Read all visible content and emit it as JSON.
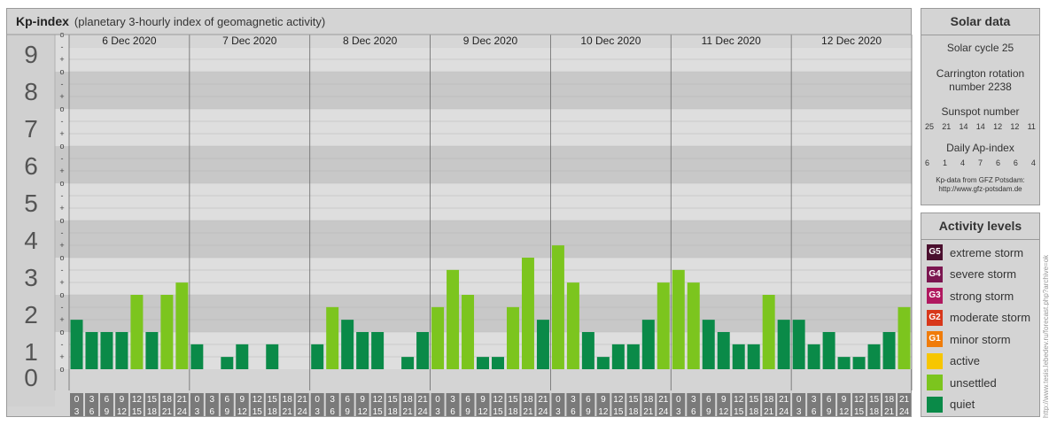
{
  "header": {
    "title": "Kp-index",
    "subtitle": "(planetary 3-hourly index of geomagnetic activity)"
  },
  "solar": {
    "title": "Solar data",
    "cycle": "Solar cycle 25",
    "carrington_line1": "Carrington rotation",
    "carrington_line2": "number 2238",
    "sunspot_title": "Sunspot number",
    "sunspot": [
      "25",
      "21",
      "14",
      "14",
      "12",
      "12",
      "11"
    ],
    "ap_title": "Daily Ap-index",
    "ap": [
      "6",
      "1",
      "4",
      "7",
      "6",
      "6",
      "4"
    ],
    "credit_line1": "Kp-data from GFZ Potsdam:",
    "credit_line2": "http://www.gfz-potsdam.de"
  },
  "activity": {
    "title": "Activity levels",
    "levels": [
      {
        "badge": "G5",
        "label": "extreme storm",
        "color": "#4a0f2e"
      },
      {
        "badge": "G4",
        "label": "severe storm",
        "color": "#7b1650"
      },
      {
        "badge": "G3",
        "label": "strong storm",
        "color": "#b0185f"
      },
      {
        "badge": "G2",
        "label": "moderate storm",
        "color": "#d8371a"
      },
      {
        "badge": "G1",
        "label": "minor storm",
        "color": "#f07c0a"
      },
      {
        "badge": "",
        "label": "active",
        "color": "#f7c600"
      },
      {
        "badge": "",
        "label": "unsettled",
        "color": "#7cc51e"
      },
      {
        "badge": "",
        "label": "quiet",
        "color": "#0a8a48"
      }
    ]
  },
  "watermark": "http://www.tesis.lebedev.ru/forecast.php?archive=ok",
  "chart_data": {
    "type": "bar",
    "title": "Kp-index",
    "ylim": [
      0,
      9
    ],
    "y_ticks": [
      "0",
      "1",
      "2",
      "3",
      "4",
      "5",
      "6",
      "7",
      "8",
      "9"
    ],
    "minor_labels": [
      "o",
      "+",
      "-"
    ],
    "days": [
      "6 Dec 2020",
      "7 Dec 2020",
      "8 Dec 2020",
      "9 Dec 2020",
      "10 Dec 2020",
      "11 Dec 2020",
      "12 Dec 2020"
    ],
    "hour_top": [
      "0",
      "3",
      "6",
      "9",
      "12",
      "15",
      "18",
      "21"
    ],
    "hour_bottom": [
      "3",
      "6",
      "9",
      "12",
      "15",
      "18",
      "21",
      "24"
    ],
    "colors": {
      "quiet": "#0a8a48",
      "unsettled": "#7cc51e"
    },
    "values": [
      1.33,
      1.0,
      1.0,
      1.0,
      2.0,
      1.0,
      2.0,
      2.33,
      0.67,
      0.0,
      0.33,
      0.67,
      0.0,
      0.67,
      0.0,
      0.0,
      0.67,
      1.67,
      1.33,
      1.0,
      1.0,
      0.0,
      0.33,
      1.0,
      1.67,
      2.67,
      2.0,
      0.33,
      0.33,
      1.67,
      3.0,
      1.33,
      3.33,
      2.33,
      1.0,
      0.33,
      0.67,
      0.67,
      1.33,
      2.33,
      2.67,
      2.33,
      1.33,
      1.0,
      0.67,
      0.67,
      2.0,
      1.33,
      1.33,
      0.67,
      1.0,
      0.33,
      0.33,
      0.67,
      1.0,
      1.67
    ]
  }
}
